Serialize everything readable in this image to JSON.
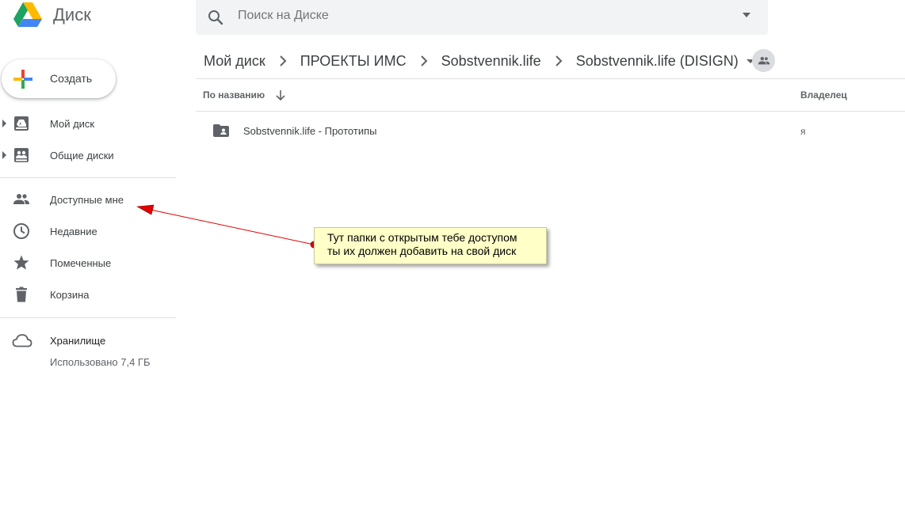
{
  "app": {
    "title": "Диск"
  },
  "search": {
    "placeholder": "Поиск на Диске"
  },
  "create": {
    "label": "Создать"
  },
  "sidebar": {
    "items": [
      {
        "label": "Мой диск",
        "icon": "my-drive-icon"
      },
      {
        "label": "Общие диски",
        "icon": "shared-drives-icon"
      },
      {
        "label": "Доступные мне",
        "icon": "shared-with-me-icon"
      },
      {
        "label": "Недавние",
        "icon": "clock-icon"
      },
      {
        "label": "Помеченные",
        "icon": "star-icon"
      },
      {
        "label": "Корзина",
        "icon": "trash-icon"
      }
    ],
    "storage": {
      "title": "Хранилище",
      "used": "Использовано 7,4 ГБ",
      "icon": "cloud-icon"
    }
  },
  "breadcrumb": [
    "Мой диск",
    "ПРОЕКТЫ ИМС",
    "Sobstvennik.life",
    "Sobstvennik.life (DISIGN)"
  ],
  "list": {
    "columns": {
      "name": "По названию",
      "owner": "Владелец"
    },
    "rows": [
      {
        "name": "Sobstvennik.life - Прототипы",
        "owner": "я",
        "icon": "shared-folder-icon"
      }
    ]
  },
  "annotation": {
    "lines": [
      "Тут папки с открытым тебе доступом",
      "ты их должен добавить на свой диск"
    ],
    "color": "#ffffc8",
    "arrow_color": "#e00000"
  },
  "colors": {
    "drive_green": "#1ea362",
    "drive_yellow": "#ffba00",
    "drive_blue": "#4285f4",
    "icon_gray": "#5f6368"
  }
}
